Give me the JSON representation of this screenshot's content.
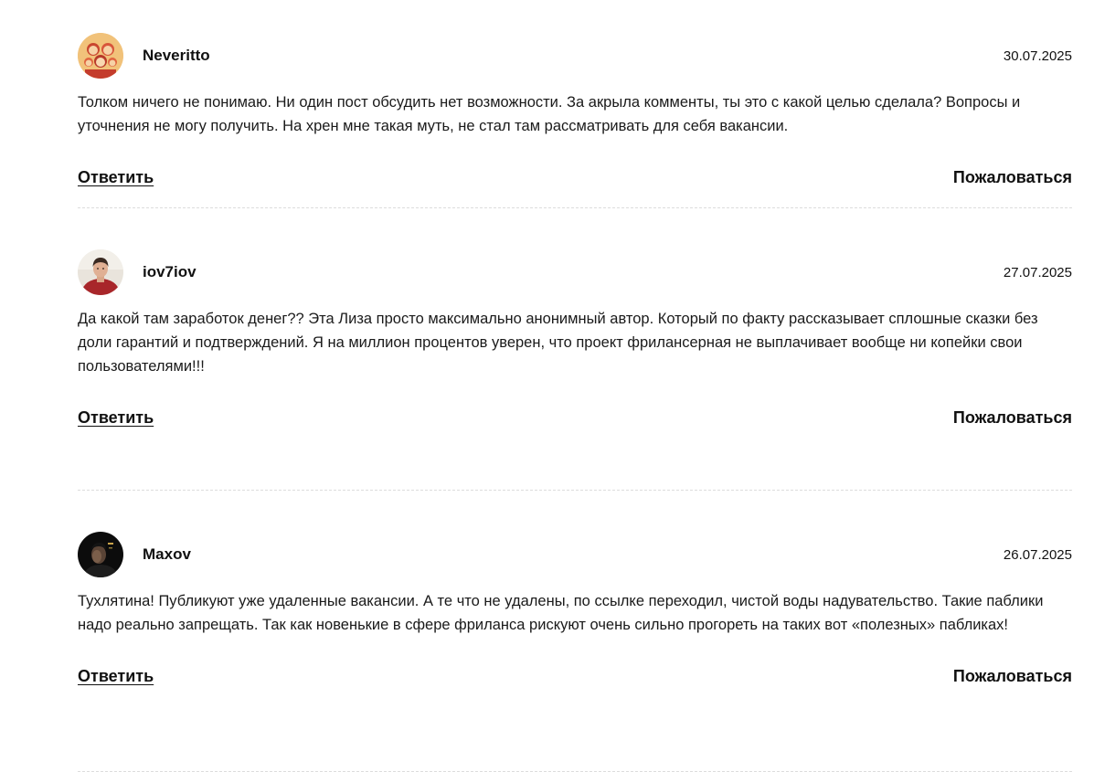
{
  "comments": [
    {
      "author": "Neveritto",
      "date": "30.07.2025",
      "avatar_icon": "avatar-cartoon-family",
      "text": "Толком ничего не понимаю. Ни один пост обсудить нет возможности. За акрыла комменты, ты это с какой целью сделала? Вопросы и уточнения не могу получить. На хрен мне такая муть, не стал там рассматривать для себя вакансии.",
      "reply_label": "Ответить",
      "report_label": "Пожаловаться"
    },
    {
      "author": "iov7iov",
      "date": "27.07.2025",
      "avatar_icon": "avatar-photo-man",
      "text": "Да какой там заработок денег?? Эта Лиза просто максимально анонимный автор. Который по факту рассказывает сплошные сказки без доли гарантий и подтверждений. Я на миллион процентов уверен, что проект фрилансерная не выплачивает вообще ни копейки свои пользователями!!!",
      "reply_label": "Ответить",
      "report_label": "Пожаловаться"
    },
    {
      "author": "Maxov",
      "date": "26.07.2025",
      "avatar_icon": "avatar-photo-dark",
      "text": "Тухлятина! Публикуют уже удаленные вакансии. А те что не удалены, по ссылке переходил, чистой воды надувательство. Такие паблики надо реально запрещать. Так как новенькие в сфере фриланса рискуют очень сильно прогореть на таких вот «полезных» пабликах!",
      "reply_label": "Ответить",
      "report_label": "Пожаловаться"
    }
  ]
}
